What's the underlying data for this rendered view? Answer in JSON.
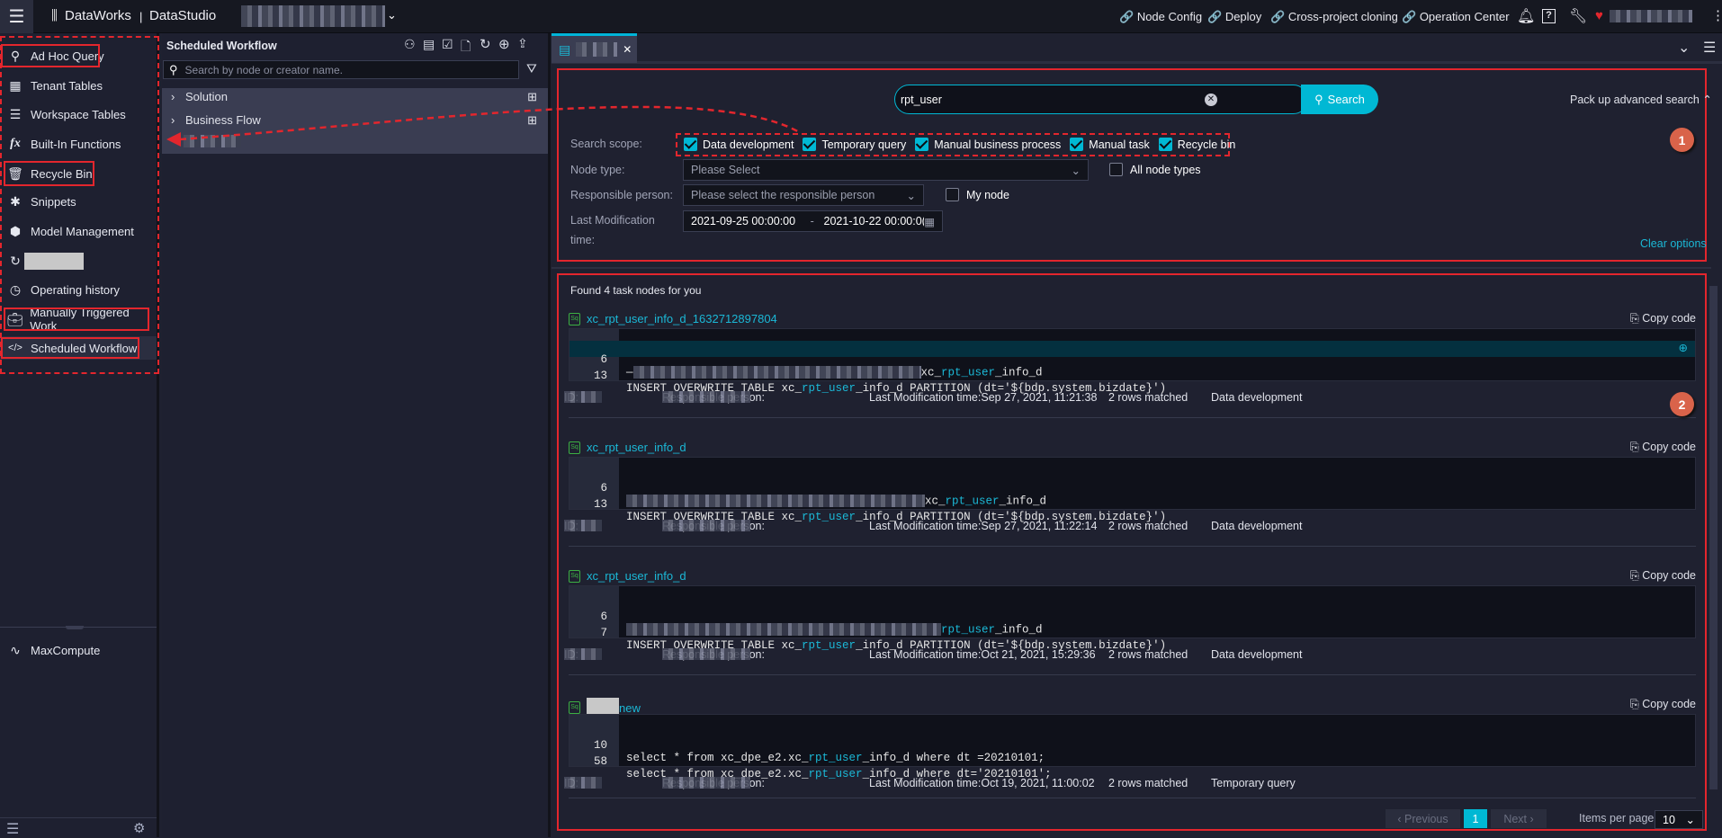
{
  "topbar": {
    "brand": "DataWorks",
    "separator": "|",
    "app": "DataStudio",
    "links": [
      "Node Config",
      "Deploy",
      "Cross-project cloning",
      "Operation Center"
    ]
  },
  "sidebar": {
    "items": [
      {
        "label": "Ad Hoc Query",
        "icon": "search-icon"
      },
      {
        "label": "Tenant Tables",
        "icon": "table-icon"
      },
      {
        "label": "Workspace Tables",
        "icon": "workspace-table-icon"
      },
      {
        "label": "Built-In Functions",
        "icon": "function-icon"
      },
      {
        "label": "Recycle Bin",
        "icon": "trash-icon"
      },
      {
        "label": "Snippets",
        "icon": "puzzle-icon"
      },
      {
        "label": "Model Management",
        "icon": "cube-icon"
      },
      {
        "label": "",
        "icon": "cursor-refresh-icon"
      },
      {
        "label": "Operating history",
        "icon": "clock-icon"
      },
      {
        "label": "Manually Triggered Work",
        "icon": "briefcase-icon"
      },
      {
        "label": "Scheduled Workflow",
        "icon": "code-icon"
      }
    ],
    "engine": "MaxCompute"
  },
  "tree": {
    "title": "Scheduled Workflow",
    "search_placeholder": "Search by node or creator name.",
    "rows": [
      "Solution",
      "Business Flow"
    ]
  },
  "search": {
    "query": "rpt_user",
    "button": "Search",
    "pack_up": "Pack up advanced search",
    "scope_label": "Search scope:",
    "scopes": [
      {
        "label": "Data development",
        "checked": true
      },
      {
        "label": "Temporary query",
        "checked": true
      },
      {
        "label": "Manual business process",
        "checked": true
      },
      {
        "label": "Manual task",
        "checked": true
      },
      {
        "label": "Recycle bin",
        "checked": true
      }
    ],
    "node_type_label": "Node type:",
    "node_type_placeholder": "Please Select",
    "all_node_types": "All node types",
    "person_label": "Responsible person:",
    "person_placeholder": "Please select the responsible person",
    "my_node": "My node",
    "time_label_1": "Last Modification",
    "time_label_2": "time:",
    "time_from": "2021-09-25 00:00:00",
    "time_sep": "-",
    "time_to": "2021-10-22 00:00:0(",
    "clear": "Clear options"
  },
  "annotations": [
    "1",
    "2"
  ],
  "results": {
    "summary": "Found 4 task nodes for you",
    "copy_label": "Copy code",
    "items": [
      {
        "title": "xc_rpt_user_info_d_1632712897804",
        "title_prefix_redacted": false,
        "lines": [
          {
            "num": "6",
            "lead": "—",
            "redacted": true,
            "pre": "xc_",
            "match": "rpt_user",
            "post": "_info_d",
            "highlight": true
          },
          {
            "num": "13",
            "lead": "",
            "redacted": false,
            "pre": "INSERT OVERWRITE TABLE xc_",
            "match": "rpt_user",
            "post": "_info_d PARTITION (dt='${bdp.system.bizdate}')",
            "highlight": false
          }
        ],
        "id_label": "ID:",
        "person_label": "Responsible person:",
        "modified": "Last Modification time:Sep 27, 2021, 11:21:38",
        "rows": "2 rows matched",
        "type": "Data development"
      },
      {
        "title": "xc_rpt_user_info_d",
        "title_prefix_redacted": false,
        "lines": [
          {
            "num": "6",
            "lead": "",
            "redacted": true,
            "pre": "xc_",
            "match": "rpt_user",
            "post": "_info_d",
            "highlight": false
          },
          {
            "num": "13",
            "lead": "",
            "redacted": false,
            "pre": "INSERT OVERWRITE TABLE xc_",
            "match": "rpt_user",
            "post": "_info_d PARTITION (dt='${bdp.system.bizdate}')",
            "highlight": false
          }
        ],
        "id_label": "ID:",
        "person_label": "Responsible person:",
        "modified": "Last Modification time:Sep 27, 2021, 11:22:14",
        "rows": "2 rows matched",
        "type": "Data development"
      },
      {
        "title": "xc_rpt_user_info_d",
        "title_prefix_redacted": false,
        "lines": [
          {
            "num": "6",
            "lead": "",
            "redacted": true,
            "pre": "",
            "match": "rpt_user",
            "post": "_info_d",
            "highlight": false
          },
          {
            "num": "7",
            "lead": "",
            "redacted": false,
            "pre": "INSERT OVERWRITE TABLE xc_",
            "match": "rpt_user",
            "post": "_info_d PARTITION (dt='${bdp.system.bizdate}')",
            "highlight": false
          }
        ],
        "id_label": "ID:",
        "person_label": "Responsible person:",
        "modified": "Last Modification time:Oct 21, 2021, 15:29:36",
        "rows": "2 rows matched",
        "type": "Data development"
      },
      {
        "title": "new",
        "title_prefix_redacted": true,
        "lines": [
          {
            "num": "10",
            "lead": "",
            "redacted": false,
            "pre": "select * from xc_dpe_e2.xc_",
            "match": "rpt_user",
            "post": "_info_d where dt =20210101;",
            "highlight": false
          },
          {
            "num": "58",
            "lead": "",
            "redacted": false,
            "pre": "select * from xc_dpe_e2.xc_",
            "match": "rpt_user",
            "post": "_info_d where dt='20210101';",
            "highlight": false
          }
        ],
        "id_label": "ID:",
        "person_label": "Responsible person:",
        "modified": "Last Modification time:Oct 19, 2021, 11:00:02",
        "rows": "2 rows matched",
        "type": "Temporary query"
      }
    ]
  },
  "pagination": {
    "previous": "Previous",
    "current": "1",
    "next": "Next",
    "per_page_label": "Items per page:",
    "per_page": "10"
  },
  "colors": {
    "accent": "#00b8d4",
    "annotation_red": "#e3262d",
    "badge": "#d9634a",
    "background": "#1f2130"
  }
}
